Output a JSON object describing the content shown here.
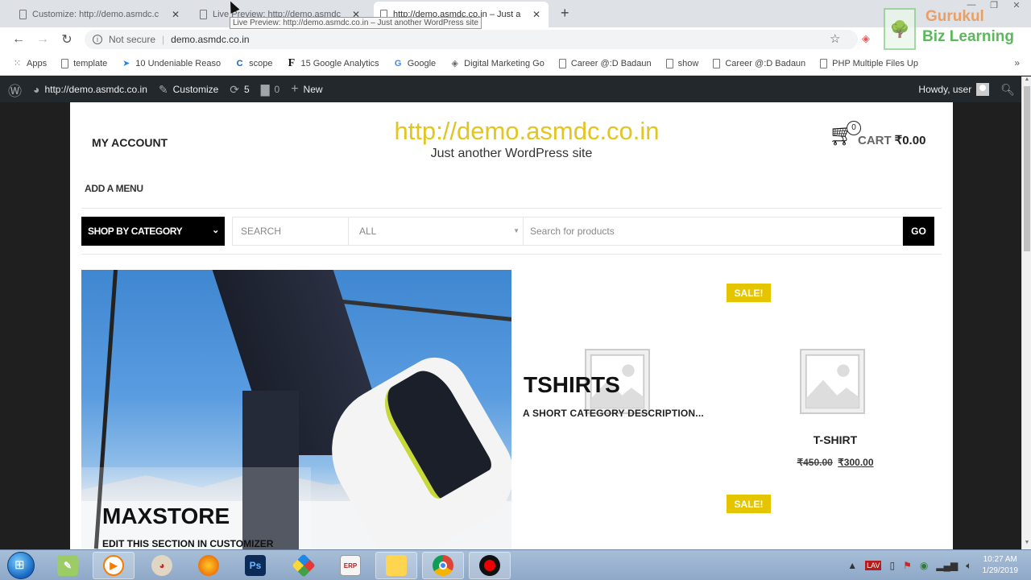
{
  "browser": {
    "tabs": [
      {
        "title": "Customize: http://demo.asmdc.c",
        "active": false
      },
      {
        "title": "Live Preview: http://demo.asmdc",
        "active": false
      },
      {
        "title": "http://demo.asmdc.co.in – Just a",
        "active": true
      }
    ],
    "tooltip": "Live Preview: http://demo.asmdc.co.in – Just another WordPress site",
    "security_label": "Not secure",
    "url": "demo.asmdc.co.in",
    "bookmarks": [
      {
        "label": "Apps",
        "icon": "apps-grid-icon"
      },
      {
        "label": "template",
        "icon": "page-icon"
      },
      {
        "label": "10 Undeniable Reaso",
        "icon": "arrow-bookmark-icon"
      },
      {
        "label": "scope",
        "icon": "c-logo-icon"
      },
      {
        "label": "15 Google Analytics",
        "icon": "f-logo-icon"
      },
      {
        "label": "Google",
        "icon": "google-icon"
      },
      {
        "label": "Digital Marketing Go",
        "icon": "diamond-icon"
      },
      {
        "label": "Career @:D Badaun",
        "icon": "page-icon"
      },
      {
        "label": "show",
        "icon": "page-icon"
      },
      {
        "label": "Career @:D Badaun",
        "icon": "page-icon"
      },
      {
        "label": "PHP Multiple Files Up",
        "icon": "page-icon"
      }
    ],
    "more_bookmarks": "»"
  },
  "watermark": {
    "line1": "Gurukul",
    "line2": "Biz Learning"
  },
  "adminbar": {
    "site": "http://demo.asmdc.co.in",
    "customize": "Customize",
    "updates": "5",
    "comments": "0",
    "new": "New",
    "howdy": "Howdy, user"
  },
  "site": {
    "my_account": "MY ACCOUNT",
    "title": "http://demo.asmdc.co.in",
    "tagline": "Just another WordPress site",
    "cart_count": "0",
    "cart_label": "CART",
    "cart_amount": "₹0.00",
    "add_menu": "ADD A MENU",
    "shop_by_category": "SHOP BY CATEGORY",
    "search_label": "SEARCH",
    "category_select": "ALL",
    "search_placeholder": "Search for products",
    "go": "GO",
    "colors": {
      "accent": "#e5c500",
      "title": "#e3c520",
      "dark": "#000000"
    }
  },
  "hero": {
    "title": "MAXSTORE",
    "subtitle": "EDIT THIS SECTION IN CUSTOMIZER"
  },
  "category": {
    "title": "TSHIRTS",
    "description": "A SHORT CATEGORY DESCRIPTION..."
  },
  "products": [
    {
      "badge": "SALE!",
      "name": "T-SHIRT",
      "old_price": "₹450.00",
      "price": "₹300.00"
    },
    {
      "badge": "SALE!"
    }
  ],
  "taskbar": {
    "apps": [
      "notepad",
      "media-player",
      "paint",
      "firefox",
      "photoshop",
      "app-launcher",
      "tally-erp",
      "file-explorer",
      "chrome",
      "recorder"
    ],
    "time": "10:27 AM",
    "date": "1/29/2019"
  }
}
